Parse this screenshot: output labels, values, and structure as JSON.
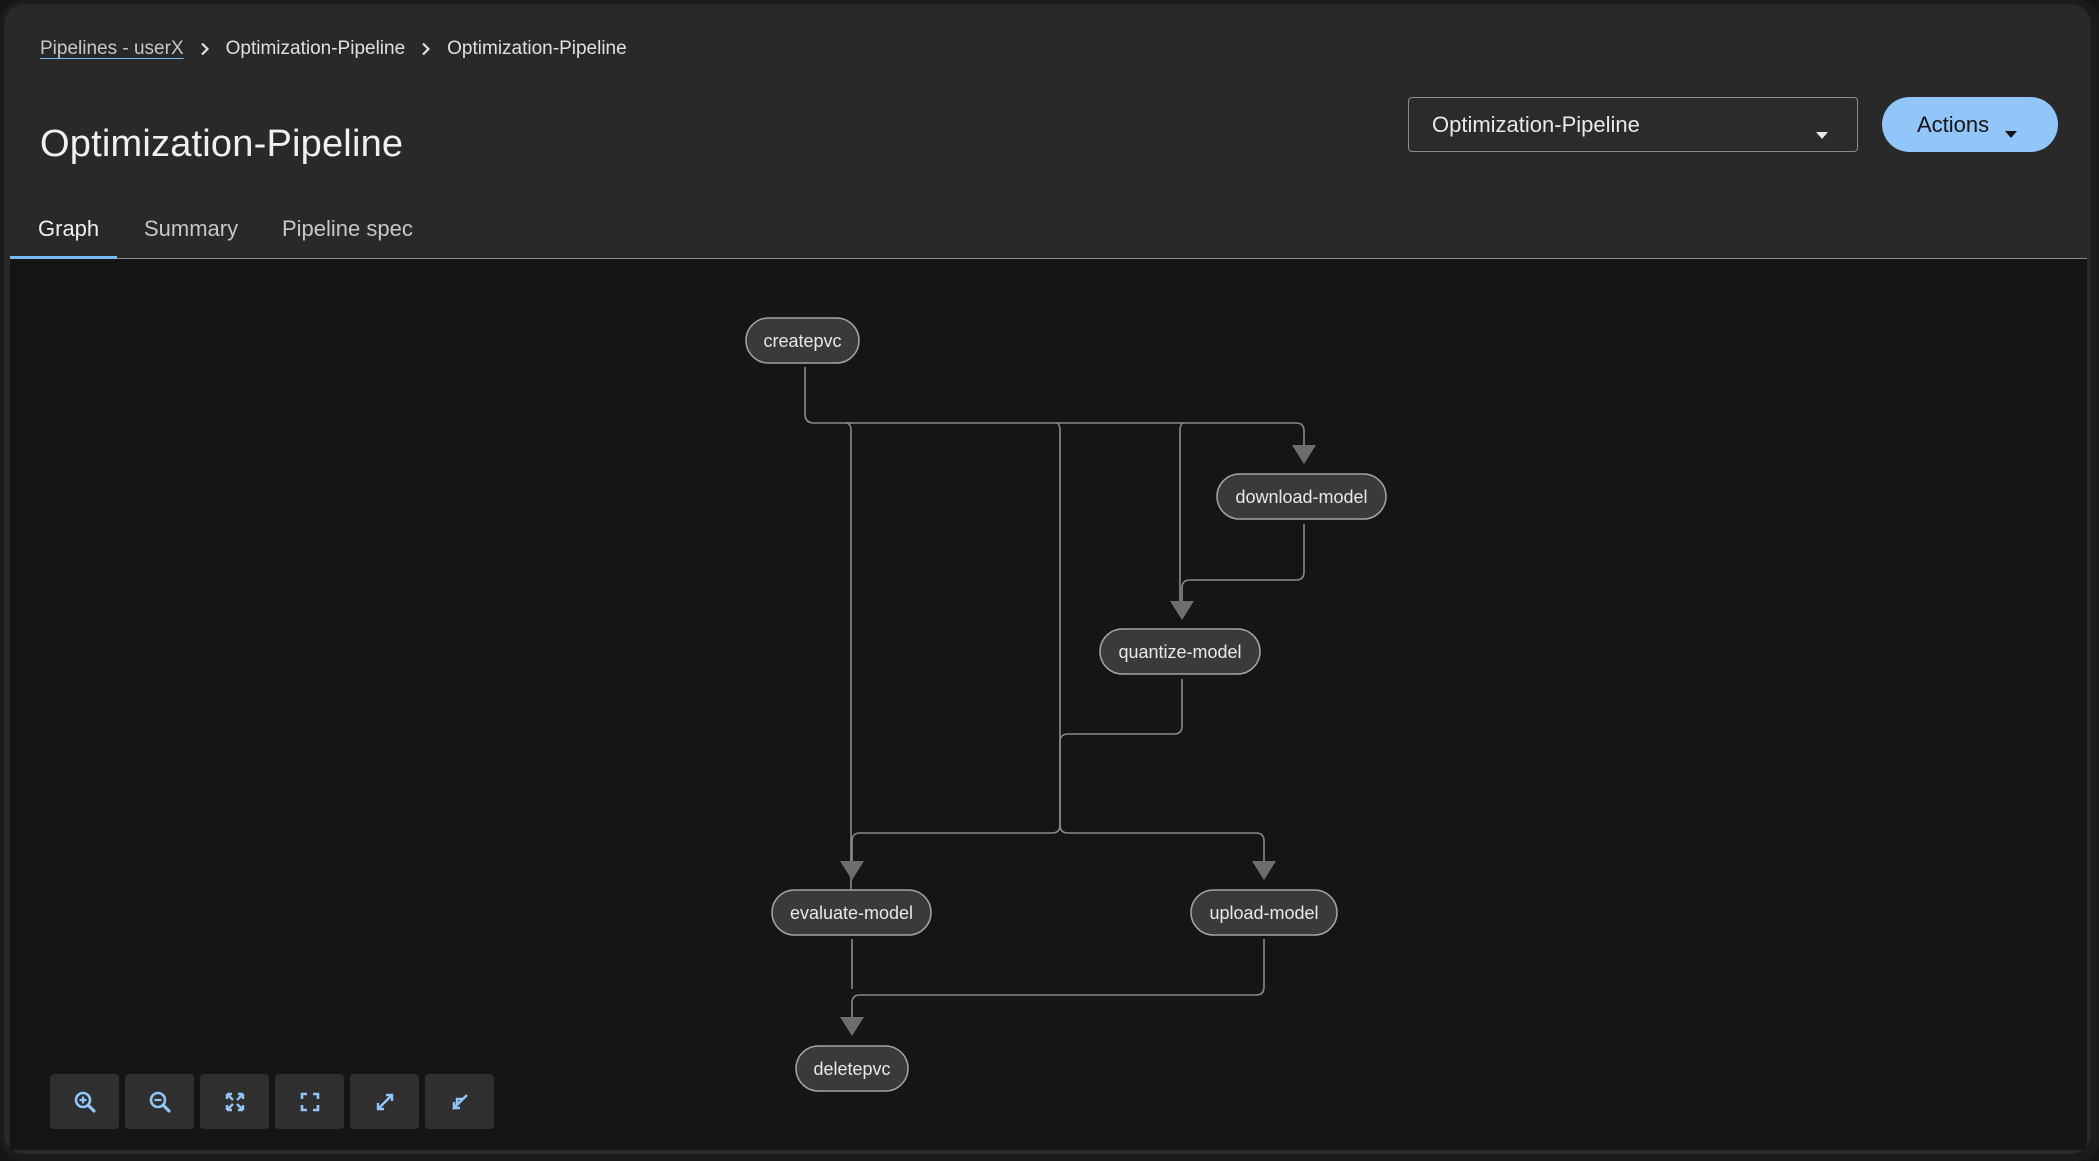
{
  "breadcrumb": {
    "root": "Pipelines - userX",
    "pipeline": "Optimization-Pipeline",
    "version": "Optimization-Pipeline"
  },
  "page": {
    "title": "Optimization-Pipeline"
  },
  "version_select": {
    "selected": "Optimization-Pipeline"
  },
  "actions": {
    "label": "Actions"
  },
  "tabs": [
    {
      "label": "Graph",
      "active": true
    },
    {
      "label": "Summary",
      "active": false
    },
    {
      "label": "Pipeline spec",
      "active": false
    }
  ],
  "graph": {
    "nodes": [
      {
        "id": "createpvc",
        "label": "createpvc"
      },
      {
        "id": "download-model",
        "label": "download-model"
      },
      {
        "id": "quantize-model",
        "label": "quantize-model"
      },
      {
        "id": "evaluate-model",
        "label": "evaluate-model"
      },
      {
        "id": "upload-model",
        "label": "upload-model"
      },
      {
        "id": "deletepvc",
        "label": "deletepvc"
      }
    ],
    "edges": [
      {
        "from": "createpvc",
        "to": "download-model"
      },
      {
        "from": "createpvc",
        "to": "quantize-model"
      },
      {
        "from": "createpvc",
        "to": "evaluate-model"
      },
      {
        "from": "createpvc",
        "to": "upload-model"
      },
      {
        "from": "download-model",
        "to": "quantize-model"
      },
      {
        "from": "quantize-model",
        "to": "evaluate-model"
      },
      {
        "from": "quantize-model",
        "to": "upload-model"
      },
      {
        "from": "evaluate-model",
        "to": "deletepvc"
      },
      {
        "from": "upload-model",
        "to": "deletepvc"
      }
    ]
  },
  "controls": [
    {
      "icon": "zoom-in-icon"
    },
    {
      "icon": "zoom-out-icon"
    },
    {
      "icon": "fit-to-screen-icon"
    },
    {
      "icon": "reset-view-icon"
    },
    {
      "icon": "expand-icon"
    },
    {
      "icon": "collapse-icon"
    }
  ],
  "colors": {
    "accent": "#73bcf7",
    "primary_button": "#92c5f9",
    "node_fill": "#3a3a3a",
    "node_stroke": "#a3a3a3",
    "edge": "#8a8a8a"
  }
}
